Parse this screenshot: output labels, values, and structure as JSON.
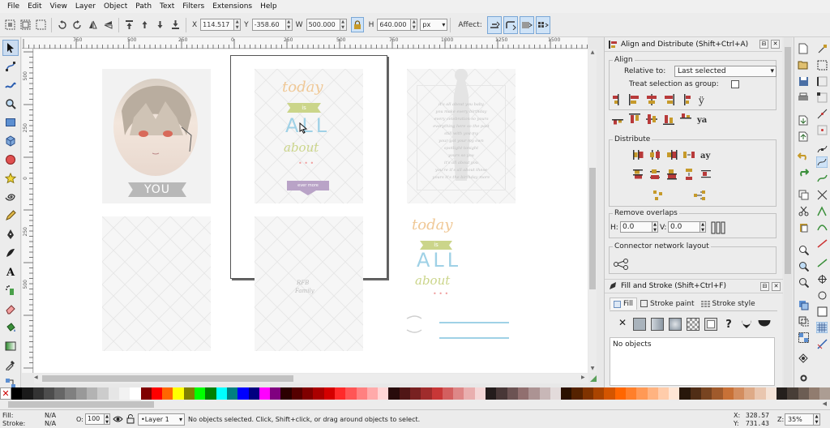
{
  "menubar": {
    "items": [
      "File",
      "Edit",
      "View",
      "Layer",
      "Object",
      "Path",
      "Text",
      "Filters",
      "Extensions",
      "Help"
    ]
  },
  "toolbar": {
    "x_label": "X",
    "x_value": "114.517",
    "y_label": "Y",
    "y_value": "-358.60",
    "w_label": "W",
    "w_value": "500.000",
    "h_label": "H",
    "h_value": "640.000",
    "unit": "px",
    "affect_label": "Affect:"
  },
  "rulers": {
    "horizontal": [
      "750",
      "500",
      "250",
      "0",
      "250",
      "500",
      "750",
      "1000",
      "1250",
      "1500"
    ],
    "vertical": [
      "500",
      "250",
      "0",
      "250",
      "500"
    ]
  },
  "canvas": {
    "card_you": "YOU",
    "card_today": "today",
    "card_is": "is",
    "card_all": "ALL",
    "card_about": "about",
    "card_dots": "• • •",
    "card_ribbon": "ever more",
    "card_rfb": "RFB",
    "card_family": "Family",
    "card_text_lines": [
      "it's all about you baby",
      "you make every birthday",
      "every celebration so yours",
      "everything here so the past",
      "still with you my",
      "your got your my own",
      "spotlight tonight",
      "yours so you",
      "it's all about you",
      "you're it's all about these",
      "yours it's the birthday more"
    ]
  },
  "align_panel": {
    "title": "Align and Distribute (Shift+Ctrl+A)",
    "align_label": "Align",
    "relative_label": "Relative to:",
    "relative_value": "Last selected",
    "group_label": "Treat selection as group:",
    "distribute_label": "Distribute",
    "overlaps_label": "Remove overlaps",
    "h_label": "H:",
    "h_value": "0.0",
    "v_label": "V:",
    "v_value": "0.0",
    "connector_label": "Connector network layout"
  },
  "fill_panel": {
    "title": "Fill and Stroke (Shift+Ctrl+F)",
    "tab_fill": "Fill",
    "tab_stroke_paint": "Stroke paint",
    "tab_stroke_style": "Stroke style",
    "no_objects": "No objects"
  },
  "palette": [
    "#000000",
    "#1a1a1a",
    "#333333",
    "#4d4d4d",
    "#666666",
    "#808080",
    "#999999",
    "#b3b3b3",
    "#cccccc",
    "#e6e6e6",
    "#f2f2f2",
    "#ffffff",
    "#800000",
    "#ff0000",
    "#ff6600",
    "#ffff00",
    "#808000",
    "#00ff00",
    "#008000",
    "#00ffff",
    "#008080",
    "#0000ff",
    "#000080",
    "#ff00ff",
    "#800080",
    "#2b0000",
    "#550000",
    "#800000",
    "#aa0000",
    "#d40000",
    "#ff2a2a",
    "#ff5555",
    "#ff8080",
    "#ffaaaa",
    "#ffd5d5",
    "#280b0b",
    "#501616",
    "#782121",
    "#a02c2c",
    "#c83737",
    "#d35f5f",
    "#de8787",
    "#e9afaf",
    "#f4d7d7",
    "#241c1c",
    "#483737",
    "#6c5353",
    "#916f6f",
    "#ac9393",
    "#c8b7b7",
    "#e3dbdb",
    "#2b1100",
    "#552200",
    "#803300",
    "#aa4400",
    "#d45500",
    "#ff6600",
    "#ff7f2a",
    "#ff9955",
    "#ffb380",
    "#ffccaa",
    "#ffe6d5",
    "#28170b",
    "#502d16",
    "#784421",
    "#a05a2c",
    "#c87137",
    "#d38d5f",
    "#deaa87",
    "#e9c6af",
    "#f4e3d7",
    "#241f1c",
    "#483e37",
    "#6c5d53",
    "#917c6f",
    "#ac9d93"
  ],
  "status": {
    "fill_label": "Fill:",
    "fill_value": "N/A",
    "stroke_label": "Stroke:",
    "stroke_value": "N/A",
    "opacity_label": "O:",
    "opacity_value": "100",
    "layer": "•Layer 1",
    "message": "No objects selected. Click, Shift+click, or drag around objects to select.",
    "x_label": "X:",
    "x_value": "328.57",
    "y_label": "Y:",
    "y_value": "731.43",
    "zoom_label": "Z:",
    "zoom_value": "35%"
  },
  "colors": {
    "accent": "#7aa7d6",
    "pastel_blue": "#9fd1e6",
    "pastel_orange": "#f0c896",
    "pastel_green": "#cbd58a",
    "pastel_pink": "#f0a0a0",
    "ribbon_purple": "#b9a3c7"
  }
}
